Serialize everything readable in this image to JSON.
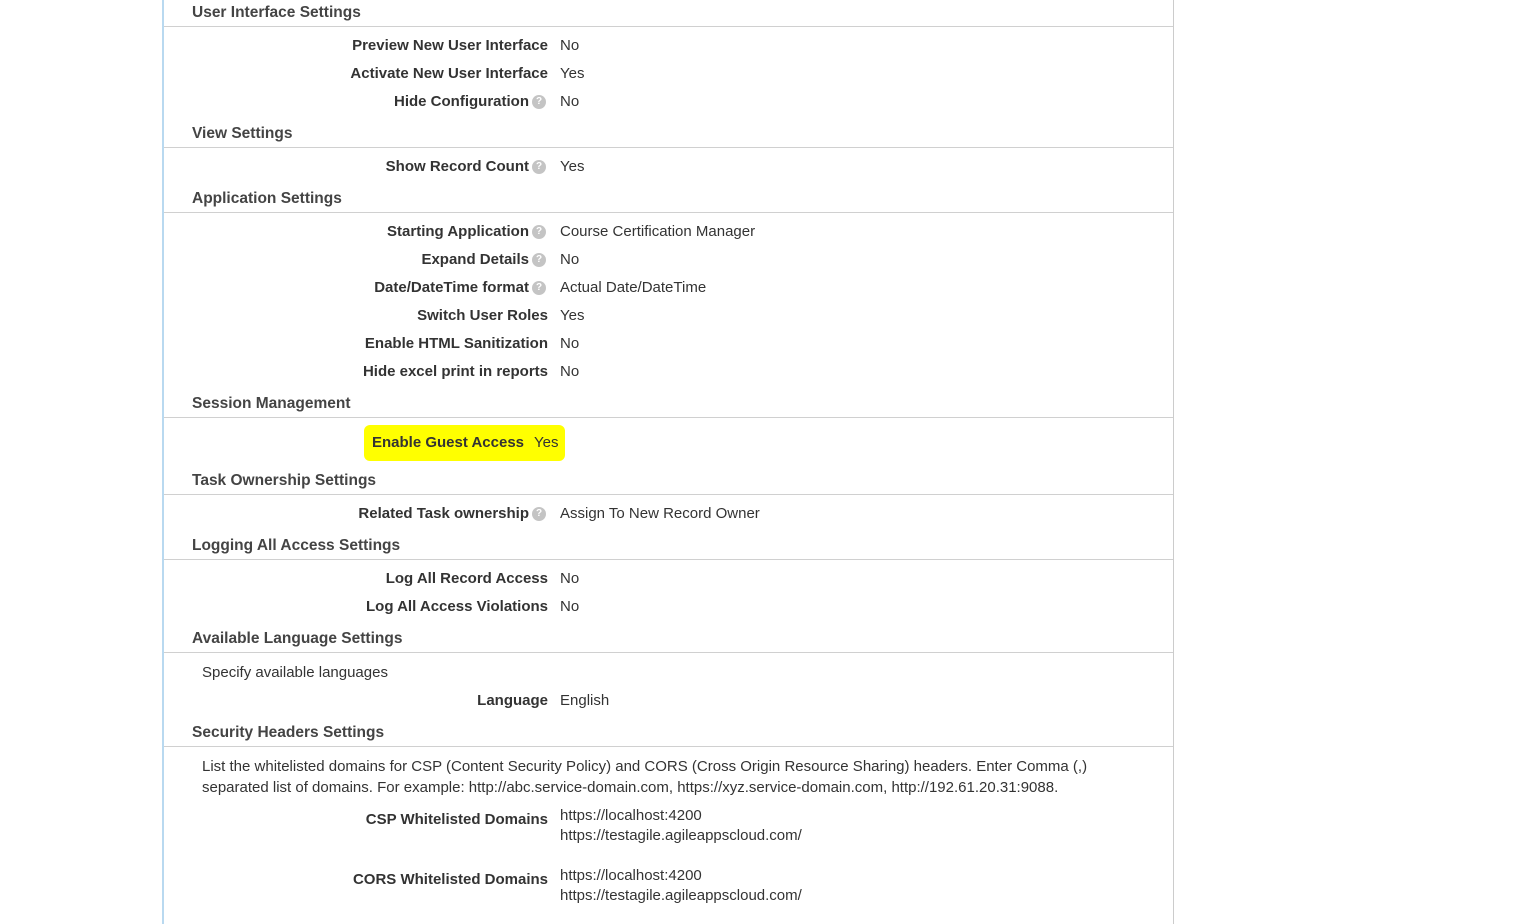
{
  "sections": {
    "ui": {
      "title": "User Interface Settings",
      "rows": [
        {
          "label": "Preview New User Interface",
          "value": "No",
          "help": false
        },
        {
          "label": "Activate New User Interface",
          "value": "Yes",
          "help": false
        },
        {
          "label": "Hide Configuration",
          "value": "No",
          "help": true
        }
      ]
    },
    "view": {
      "title": "View Settings",
      "rows": [
        {
          "label": "Show Record Count",
          "value": "Yes",
          "help": true
        }
      ]
    },
    "app": {
      "title": "Application Settings",
      "rows": [
        {
          "label": "Starting Application",
          "value": "Course Certification Manager",
          "help": true
        },
        {
          "label": "Expand Details",
          "value": "No",
          "help": true
        },
        {
          "label": "Date/DateTime format",
          "value": "Actual Date/DateTime",
          "help": true
        },
        {
          "label": "Switch User Roles",
          "value": "Yes",
          "help": false
        },
        {
          "label": "Enable HTML Sanitization",
          "value": "No",
          "help": false
        },
        {
          "label": "Hide excel print in reports",
          "value": "No",
          "help": false
        }
      ]
    },
    "session": {
      "title": "Session Management",
      "rows": [
        {
          "label": "Enable Guest Access",
          "value": "Yes",
          "help": false,
          "highlighted": true
        }
      ]
    },
    "task": {
      "title": "Task Ownership Settings",
      "rows": [
        {
          "label": "Related Task ownership",
          "value": "Assign To New Record Owner",
          "help": true
        }
      ]
    },
    "logging": {
      "title": "Logging All Access Settings",
      "rows": [
        {
          "label": "Log All Record Access",
          "value": "No",
          "help": false
        },
        {
          "label": "Log All Access Violations",
          "value": "No",
          "help": false
        }
      ]
    },
    "lang": {
      "title": "Available Language Settings",
      "instruction": "Specify available languages",
      "rows": [
        {
          "label": "Language",
          "value": "English",
          "help": false
        }
      ]
    },
    "security": {
      "title": "Security Headers Settings",
      "instruction": "List the whitelisted domains for CSP (Content Security Policy) and CORS (Cross Origin Resource Sharing) headers. Enter Comma (,) separated list of domains. For example: http://abc.service-domain.com, https://xyz.service-domain.com, http://192.61.20.31:9088.",
      "csp": {
        "label": "CSP Whitelisted Domains",
        "values": [
          "https://localhost:4200",
          "https://testagile.agileappscloud.com/"
        ]
      },
      "cors": {
        "label": "CORS Whitelisted Domains",
        "values": [
          "https://localhost:4200",
          "https://testagile.agileappscloud.com/"
        ]
      }
    }
  },
  "help_glyph": "?"
}
